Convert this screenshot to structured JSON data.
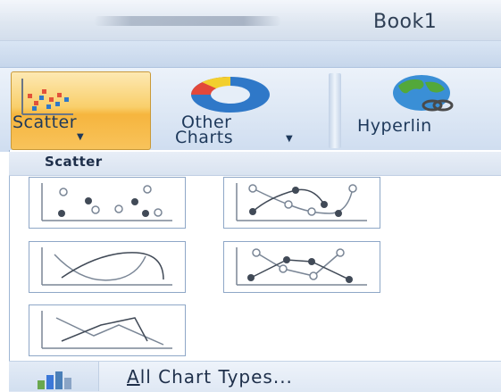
{
  "window": {
    "title": "Book1"
  },
  "ribbon": {
    "scatter_label": "Scatter",
    "other_label_line1": "Other",
    "other_label_line2": "Charts",
    "hyperlink_label": "Hyperlin"
  },
  "menu": {
    "header": "Scatter",
    "tiles": [
      {
        "name": "scatter-markers-only"
      },
      {
        "name": "scatter-smooth-lines-markers"
      },
      {
        "name": "scatter-smooth-lines"
      },
      {
        "name": "scatter-straight-lines-markers"
      },
      {
        "name": "scatter-straight-lines"
      }
    ],
    "footer_accel": "A",
    "footer_rest": "ll Chart Types..."
  },
  "colors": {
    "selected_button": "#f8c35b",
    "accent_blue": "#2f78c8"
  },
  "icons": [
    "scatter-chart-icon",
    "doughnut-chart-icon",
    "globe-hyperlink-icon",
    "bar-chart-icon"
  ]
}
